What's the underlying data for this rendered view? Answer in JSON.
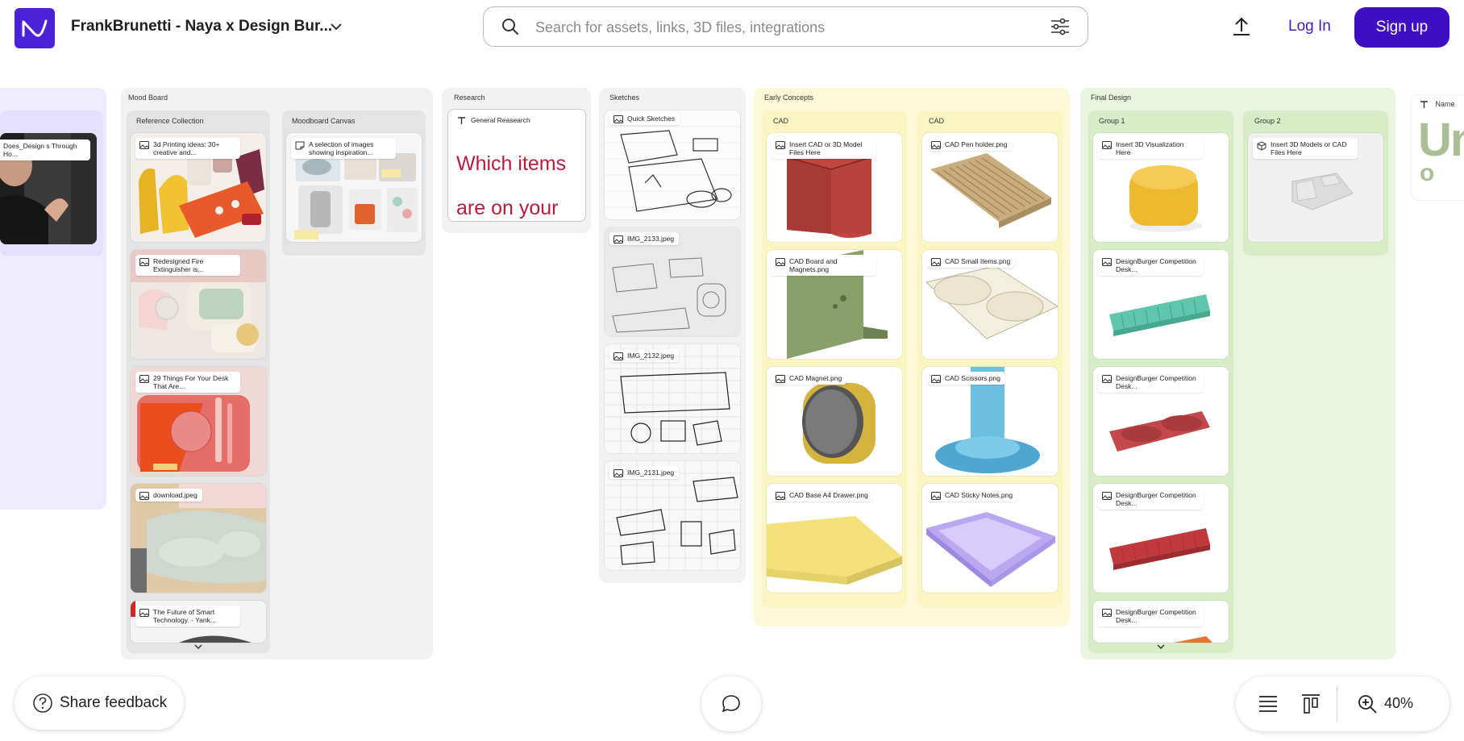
{
  "header": {
    "title": "FrankBrunetti - Naya x Design Bur...",
    "search_placeholder": "Search for assets, links, 3D files, integrations",
    "login_label": "Log In",
    "signup_label": "Sign up"
  },
  "canvas": {
    "video_card_label": "Does_Design s Through Ho...",
    "mood_board": {
      "label": "Mood Board",
      "reference_collection": {
        "label": "Reference Collection",
        "cards": [
          "3d Printing ideas: 30+ creative and...",
          "Redesigned Fire Extinguisher is...",
          "29 Things For Your Desk That Are...",
          "download.jpeg",
          "The Future of Smart Technology. - Yank..."
        ]
      },
      "moodboard_canvas": {
        "label": "Moodboard Canvas",
        "card": "A selection of images showing inspiration..."
      }
    },
    "research": {
      "label": "Research",
      "card_title": "General Reasearch",
      "card_text": "Which items are on your"
    },
    "sketches": {
      "label": "Sketches",
      "cards": [
        "Quick Sketches",
        "IMG_2133.jpeg",
        "IMG_2132.jpeg",
        "IMG_2131.jpeg"
      ]
    },
    "early_concepts": {
      "label": "Early Concepts",
      "col1": {
        "label": "CAD",
        "cards": [
          "Insert CAD or 3D Model Files Here",
          "CAD Board and Magnets.png",
          "CAD Magnet.png",
          "CAD Base A4 Drawer.png"
        ]
      },
      "col2": {
        "label": "CAD",
        "cards": [
          "CAD Pen holder.png",
          "CAD Small Items.png",
          "CAD Scissors.png",
          "CAD Sticky Notes.png"
        ]
      }
    },
    "final_design": {
      "label": "Final Design",
      "group1": {
        "label": "Group 1",
        "cards": [
          "Insert 3D Visualization Here",
          "DesignBurger Competition Desk...",
          "DesignBurger Competition Desk...",
          "DesignBurger Competition Desk...",
          "DesignBurger Competition Desk..."
        ]
      },
      "group2": {
        "label": "Group 2",
        "cards": [
          "Insert 3D Models or CAD Files Here"
        ]
      }
    },
    "name_card": {
      "label": "Name",
      "text": "Un",
      "sub": "o"
    }
  },
  "footer": {
    "feedback_label": "Share feedback",
    "zoom_value": "40%"
  },
  "colors": {
    "brand": "#4b22d8",
    "signup": "#3e0ec2",
    "research_text": "#b81c3c",
    "area_purple": "#efebff",
    "area_gray": "#f2f2f2",
    "area_yellow": "#fdf9d8",
    "area_green": "#eaf5e0"
  }
}
